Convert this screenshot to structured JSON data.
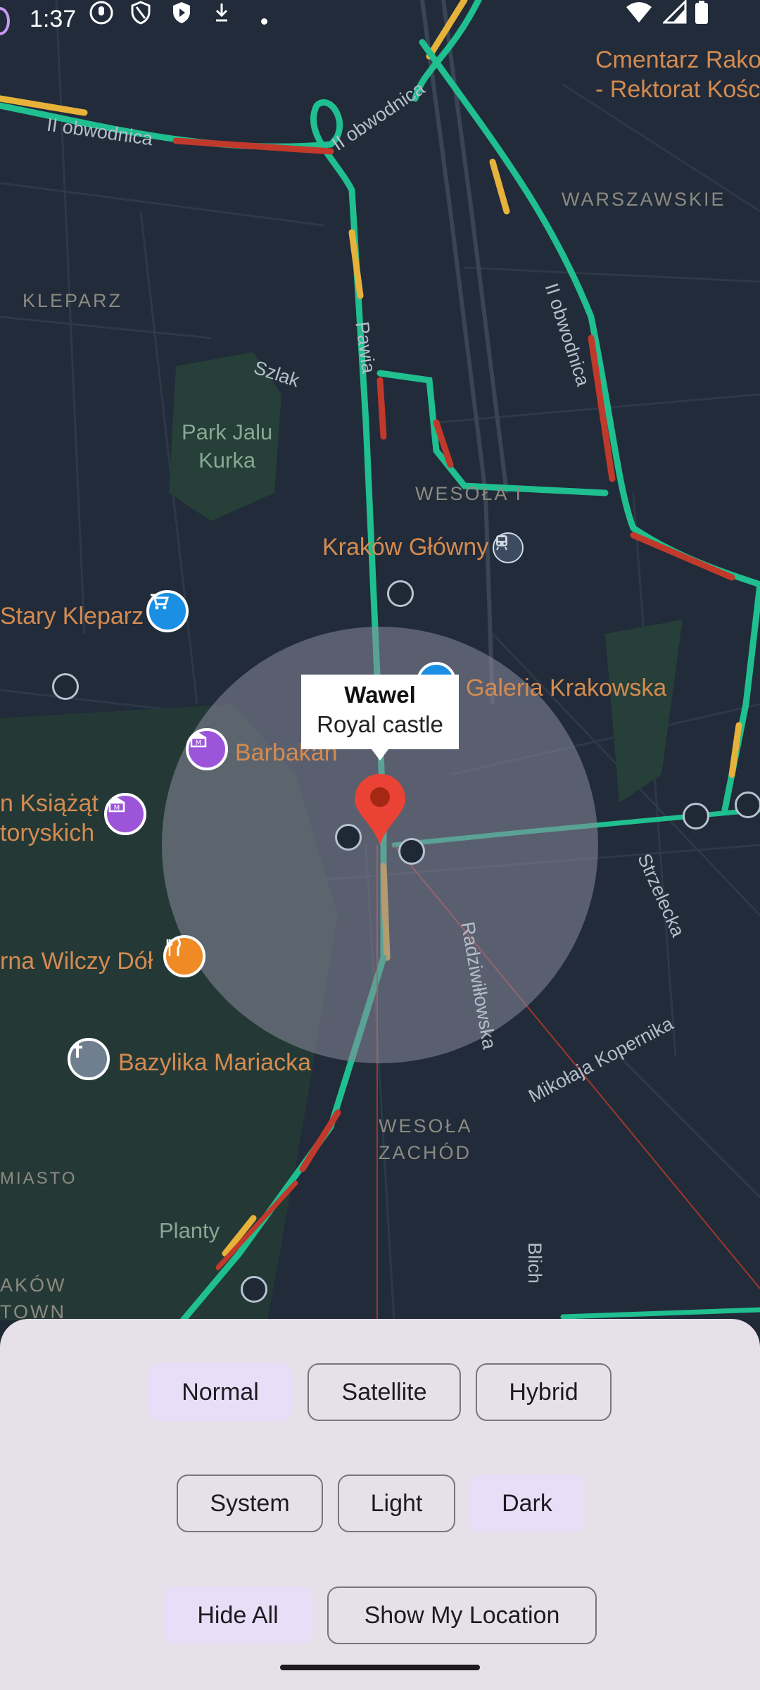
{
  "status_bar": {
    "time": "1:37",
    "left_icons": [
      "mic-sound-icon",
      "shield-outline-icon",
      "shield-filled-icon",
      "download-arrow-icon",
      "dot-icon"
    ],
    "right_icons": [
      "wifi-icon",
      "signal-icon",
      "battery-icon"
    ]
  },
  "map": {
    "districts": [
      "KLEPARZ",
      "WARSZAWSKIE",
      "WESOŁA I",
      "WESOŁA\nZACHÓD",
      "MIASTO",
      "AKÓW\nTOWN"
    ],
    "parks": [
      "Park Jalu\nKurka",
      "Planty"
    ],
    "streets": [
      "II obwodnica",
      "II obwodnica",
      "II obwodnica",
      "Szlak",
      "Pawia",
      "Radziwiłłowska",
      "Strzelecka",
      "Mikołaja Kopernika",
      "Blich"
    ],
    "pois": [
      {
        "name": "Cmentarz Rako\n- Rektorat Kośc",
        "icon": ""
      },
      {
        "name": "Kraków Główny",
        "icon": "train-icon"
      },
      {
        "name": "Stary Kleparz",
        "icon": "shopping-cart-icon"
      },
      {
        "name": "Galeria Krakowska",
        "icon": "shopping-bag-icon"
      },
      {
        "name": "Barbakan",
        "icon": "museum-icon"
      },
      {
        "name": "n Książąt\ntoryskich",
        "icon": "museum-icon"
      },
      {
        "name": "rna Wilczy Dół",
        "icon": "restaurant-icon"
      },
      {
        "name": "Bazylika Mariacka",
        "icon": "church-cross-icon"
      }
    ],
    "marker": {
      "title": "Wawel",
      "snippet": "Royal castle"
    },
    "colors": {
      "background": "#212b39",
      "traffic_green": "#1fbf8f",
      "traffic_red": "#c0392b",
      "traffic_yellow": "#e6b23a",
      "circle_fill": "#8a8a9c"
    }
  },
  "controls": {
    "map_type": {
      "options": [
        "Normal",
        "Satellite",
        "Hybrid"
      ],
      "selected": "Normal"
    },
    "theme": {
      "options": [
        "System",
        "Light",
        "Dark"
      ],
      "selected": "Dark"
    },
    "actions": {
      "hide_all": "Hide All",
      "show_my_location": "Show My Location"
    }
  }
}
